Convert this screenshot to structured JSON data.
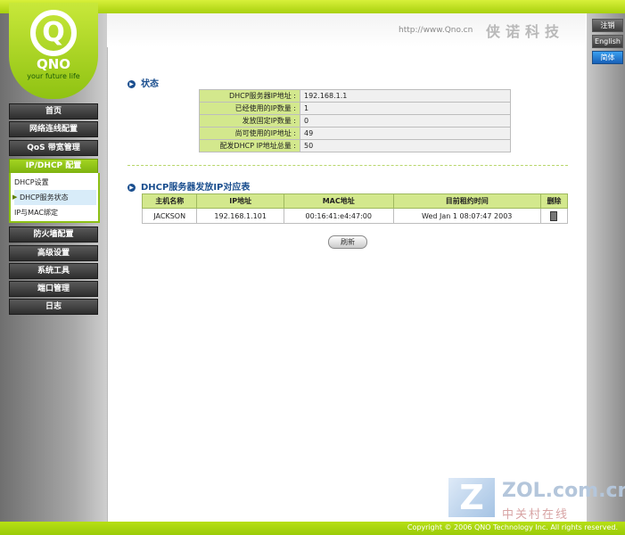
{
  "logo": {
    "letter": "Q",
    "name": "QNO",
    "slogan": "your future life"
  },
  "header": {
    "url": "http://www.Qno.cn",
    "brand_cn": "侠诺科技"
  },
  "right_buttons": [
    "注销",
    "English",
    "简体"
  ],
  "nav": {
    "items": [
      "首页",
      "网络连线配置",
      "QoS 带宽管理",
      "IP/DHCP 配置",
      "防火墙配置",
      "高级设置",
      "系统工具",
      "端口管理",
      "日志"
    ],
    "sub_items": [
      "DHCP设置",
      "DHCP服务状态",
      "IP与MAC绑定"
    ]
  },
  "status": {
    "title": "状态",
    "rows": [
      {
        "label": "DHCP服务器IP地址 :",
        "value": "192.168.1.1"
      },
      {
        "label": "已经使用的IP数量 :",
        "value": "1"
      },
      {
        "label": "发放固定IP数量 :",
        "value": "0"
      },
      {
        "label": "尚可使用的IP地址 :",
        "value": "49"
      },
      {
        "label": "配发DHCP IP地址总量 :",
        "value": "50"
      }
    ]
  },
  "dhcp_table": {
    "title": "DHCP服务器发放IP对应表",
    "headers": [
      "主机名称",
      "IP地址",
      "MAC地址",
      "目前租约时间",
      "删除"
    ],
    "rows": [
      {
        "host": "JACKSON",
        "ip": "192.168.1.101",
        "mac": "00:16:41:e4:47:00",
        "lease": "Wed Jan 1 08:07:47 2003"
      }
    ]
  },
  "refresh_label": "刷新",
  "footer": "Copyright © 2006 QNO Technology Inc. All rights reserved.",
  "watermark": {
    "logo_letter": "Z",
    "text": "ZOL.com.cn",
    "cn": "中关村在线"
  },
  "colors": {
    "accent": "#a8d10e",
    "title": "#1b4f8f",
    "table_key": "#d3e88d",
    "active_button": "#1760b8"
  }
}
